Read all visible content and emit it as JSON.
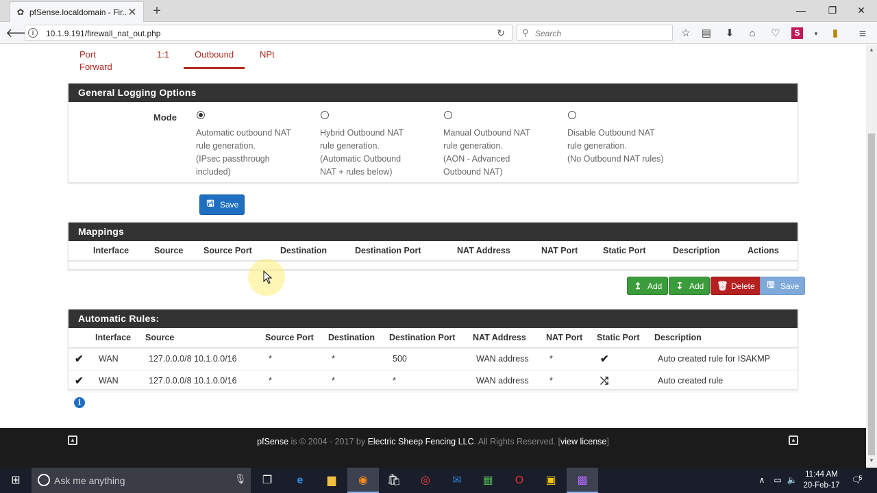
{
  "browser": {
    "tab_title": "pfSense.localdomain - Fir...",
    "url": "10.1.9.191/firewall_nat_out.php",
    "search_placeholder": "Search"
  },
  "subtabs": [
    "Port Forward",
    "1:1",
    "Outbound",
    "NPt"
  ],
  "general": {
    "title": "General Logging Options",
    "mode_label": "Mode",
    "options": [
      {
        "lines": [
          "Automatic outbound NAT",
          "rule generation.",
          "(IPsec passthrough",
          "included)"
        ],
        "checked": true
      },
      {
        "lines": [
          "Hybrid Outbound NAT",
          "rule generation.",
          "(Automatic Outbound",
          "NAT + rules below)"
        ],
        "checked": false
      },
      {
        "lines": [
          "Manual Outbound NAT",
          "rule generation.",
          "(AON - Advanced",
          "Outbound NAT)"
        ],
        "checked": false
      },
      {
        "lines": [
          "Disable Outbound NAT",
          "rule generation.",
          "(No Outbound NAT rules)",
          ""
        ],
        "checked": false
      }
    ],
    "save_label": "Save"
  },
  "mappings": {
    "title": "Mappings",
    "columns": [
      "Interface",
      "Source",
      "Source Port",
      "Destination",
      "Destination Port",
      "NAT Address",
      "NAT Port",
      "Static Port",
      "Description",
      "Actions"
    ],
    "buttons": {
      "add_top": "Add",
      "add_bottom": "Add",
      "delete": "Delete",
      "save": "Save"
    }
  },
  "auto_rules": {
    "title": "Automatic Rules:",
    "columns": [
      "Interface",
      "Source",
      "Source Port",
      "Destination",
      "Destination Port",
      "NAT Address",
      "NAT Port",
      "Static Port",
      "Description"
    ],
    "rows": [
      {
        "interface": "WAN",
        "source": "127.0.0.0/8 10.1.0.0/16",
        "source_port": "*",
        "destination": "*",
        "destination_port": "500",
        "nat_address": "WAN address",
        "nat_port": "*",
        "static_port": "check-icon",
        "description": "Auto created rule for ISAKMP"
      },
      {
        "interface": "WAN",
        "source": "127.0.0.0/8 10.1.0.0/16",
        "source_port": "*",
        "destination": "*",
        "destination_port": "*",
        "nat_address": "WAN address",
        "nat_port": "*",
        "static_port": "shuffle-icon",
        "description": "Auto created rule"
      }
    ]
  },
  "footer": {
    "brand": "pfSense",
    "text1": " is © 2004 - 2017 by ",
    "company": "Electric Sheep Fencing LLC",
    "text2": ". All Rights Reserved. [",
    "license": "view license",
    "text3": "]"
  },
  "taskbar": {
    "search_text": "Ask me anything",
    "time": "11:44 AM",
    "date": "20-Feb-17",
    "notification_count": "5"
  },
  "colors": {
    "tab_accent": "#b02a1f",
    "panel_heading": "#333333",
    "primary": "#1e6fc0",
    "success": "#3b9c3b",
    "danger": "#b52020"
  }
}
